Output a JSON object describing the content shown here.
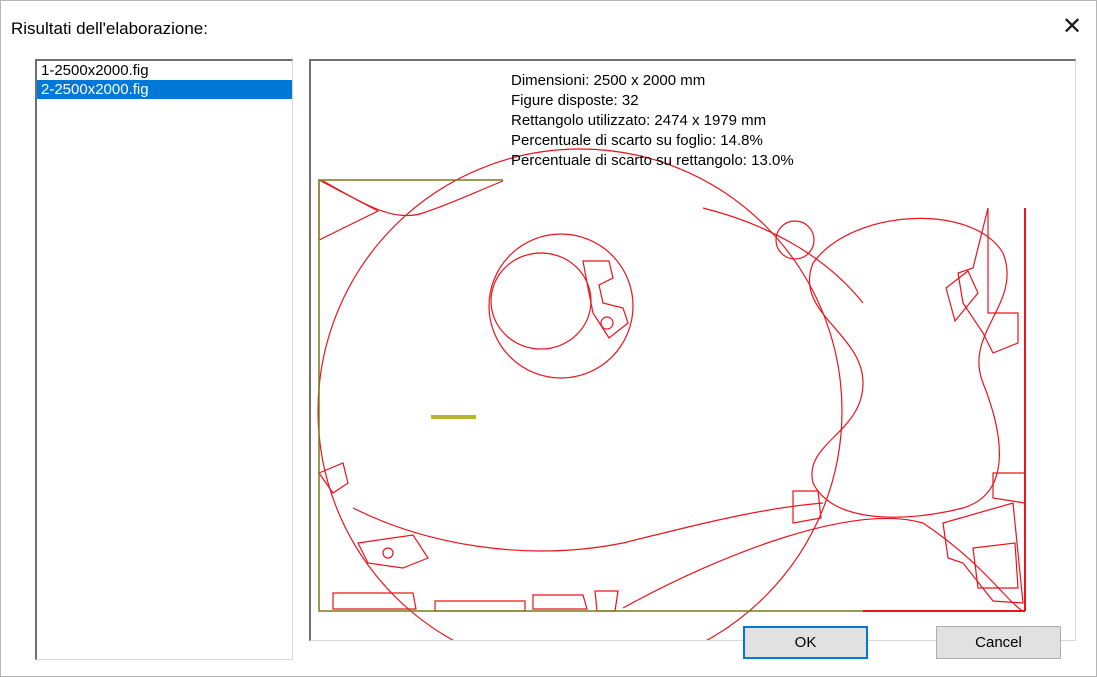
{
  "dialog": {
    "title": "Risultati dell'elaborazione:",
    "close_icon": "close-icon"
  },
  "files": [
    {
      "label": "1-2500x2000.fig",
      "selected": false
    },
    {
      "label": "2-2500x2000.fig",
      "selected": true
    }
  ],
  "results": {
    "dimensions": "Dimensioni: 2500 x 2000 mm",
    "figures": "Figure disposte: 32",
    "rectangle": "Rettangolo utilizzato: 2474 x 1979 mm",
    "waste_sheet": "Percentuale di scarto su foglio: 14.8%",
    "waste_rect": "Percentuale di scarto su rettangolo: 13.0%"
  },
  "buttons": {
    "ok": "OK",
    "cancel": "Cancel"
  },
  "colors": {
    "shape_stroke": "#e8141e",
    "sheet_border": "#7a7a1e",
    "selection": "#0078d7"
  }
}
